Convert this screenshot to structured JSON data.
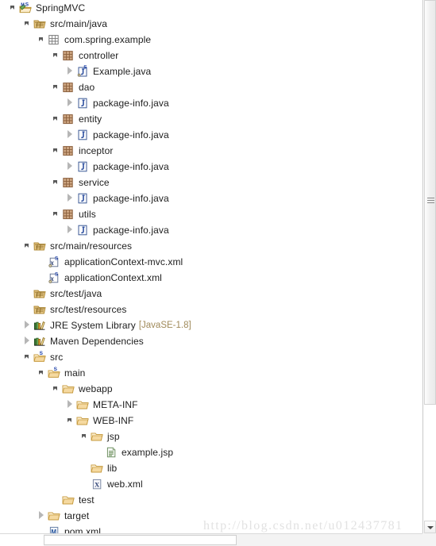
{
  "view": {
    "name": "package-explorer",
    "watermark": "http://blog.csdn.net/u012437781"
  },
  "colors": {
    "label": "#1d1d1d",
    "suffix": "#a08a5a",
    "folder": "#f0c060",
    "package_fill": "#c8a080",
    "arrow": "#5a5a5a",
    "background": "#ffffff"
  },
  "tree": {
    "nodes": [
      {
        "label": "SpringMVC",
        "depth": 0,
        "icon": "project-java-svn-icon",
        "state": "open",
        "suffix": ""
      },
      {
        "label": "src/main/java",
        "depth": 1,
        "icon": "source-folder-icon",
        "state": "open",
        "suffix": ""
      },
      {
        "label": "com.spring.example",
        "depth": 2,
        "icon": "package-empty-icon",
        "state": "open",
        "suffix": ""
      },
      {
        "label": "controller",
        "depth": 3,
        "icon": "package-icon",
        "state": "open",
        "suffix": ""
      },
      {
        "label": "Example.java",
        "depth": 4,
        "icon": "java-file-svn-icon",
        "state": "closed",
        "suffix": ""
      },
      {
        "label": "dao",
        "depth": 3,
        "icon": "package-icon",
        "state": "open",
        "suffix": ""
      },
      {
        "label": "package-info.java",
        "depth": 4,
        "icon": "java-file-icon",
        "state": "closed",
        "suffix": ""
      },
      {
        "label": "entity",
        "depth": 3,
        "icon": "package-icon",
        "state": "open",
        "suffix": ""
      },
      {
        "label": "package-info.java",
        "depth": 4,
        "icon": "java-file-icon",
        "state": "closed",
        "suffix": ""
      },
      {
        "label": "inceptor",
        "depth": 3,
        "icon": "package-icon",
        "state": "open",
        "suffix": ""
      },
      {
        "label": "package-info.java",
        "depth": 4,
        "icon": "java-file-icon",
        "state": "closed",
        "suffix": ""
      },
      {
        "label": "service",
        "depth": 3,
        "icon": "package-icon",
        "state": "open",
        "suffix": ""
      },
      {
        "label": "package-info.java",
        "depth": 4,
        "icon": "java-file-icon",
        "state": "closed",
        "suffix": ""
      },
      {
        "label": "utils",
        "depth": 3,
        "icon": "package-icon",
        "state": "open",
        "suffix": ""
      },
      {
        "label": "package-info.java",
        "depth": 4,
        "icon": "java-file-icon",
        "state": "closed",
        "suffix": ""
      },
      {
        "label": "src/main/resources",
        "depth": 1,
        "icon": "source-folder-icon",
        "state": "open",
        "suffix": ""
      },
      {
        "label": "applicationContext-mvc.xml",
        "depth": 2,
        "icon": "xml-spring-file-icon",
        "state": "none",
        "suffix": ""
      },
      {
        "label": "applicationContext.xml",
        "depth": 2,
        "icon": "xml-spring-file-icon",
        "state": "none",
        "suffix": ""
      },
      {
        "label": "src/test/java",
        "depth": 1,
        "icon": "source-folder-icon",
        "state": "none",
        "suffix": ""
      },
      {
        "label": "src/test/resources",
        "depth": 1,
        "icon": "source-folder-icon",
        "state": "none",
        "suffix": ""
      },
      {
        "label": "JRE System Library",
        "depth": 1,
        "icon": "library-icon",
        "state": "closed",
        "suffix": "[JavaSE-1.8]"
      },
      {
        "label": "Maven Dependencies",
        "depth": 1,
        "icon": "library-icon",
        "state": "closed",
        "suffix": ""
      },
      {
        "label": "src",
        "depth": 1,
        "icon": "folder-svn-icon",
        "state": "open",
        "suffix": ""
      },
      {
        "label": "main",
        "depth": 2,
        "icon": "folder-svn-icon",
        "state": "open",
        "suffix": ""
      },
      {
        "label": "webapp",
        "depth": 3,
        "icon": "folder-icon",
        "state": "open",
        "suffix": ""
      },
      {
        "label": "META-INF",
        "depth": 4,
        "icon": "folder-icon",
        "state": "closed",
        "suffix": ""
      },
      {
        "label": "WEB-INF",
        "depth": 4,
        "icon": "folder-icon",
        "state": "open",
        "suffix": ""
      },
      {
        "label": "jsp",
        "depth": 5,
        "icon": "folder-icon",
        "state": "open",
        "suffix": ""
      },
      {
        "label": "example.jsp",
        "depth": 6,
        "icon": "jsp-file-icon",
        "state": "none",
        "suffix": ""
      },
      {
        "label": "lib",
        "depth": 5,
        "icon": "folder-icon",
        "state": "none",
        "suffix": ""
      },
      {
        "label": "web.xml",
        "depth": 5,
        "icon": "xml-file-icon",
        "state": "none",
        "suffix": ""
      },
      {
        "label": "test",
        "depth": 3,
        "icon": "folder-icon",
        "state": "none",
        "suffix": ""
      },
      {
        "label": "target",
        "depth": 2,
        "icon": "folder-icon",
        "state": "closed",
        "suffix": ""
      },
      {
        "label": "pom.xml",
        "depth": 2,
        "icon": "maven-pom-icon",
        "state": "none",
        "suffix": ""
      }
    ]
  },
  "scrollbars": {
    "vertical": {
      "name": "vertical-scrollbar",
      "thumb_height": 510
    },
    "horizontal": {
      "name": "horizontal-scrollbar",
      "thumb_width": 243
    }
  }
}
